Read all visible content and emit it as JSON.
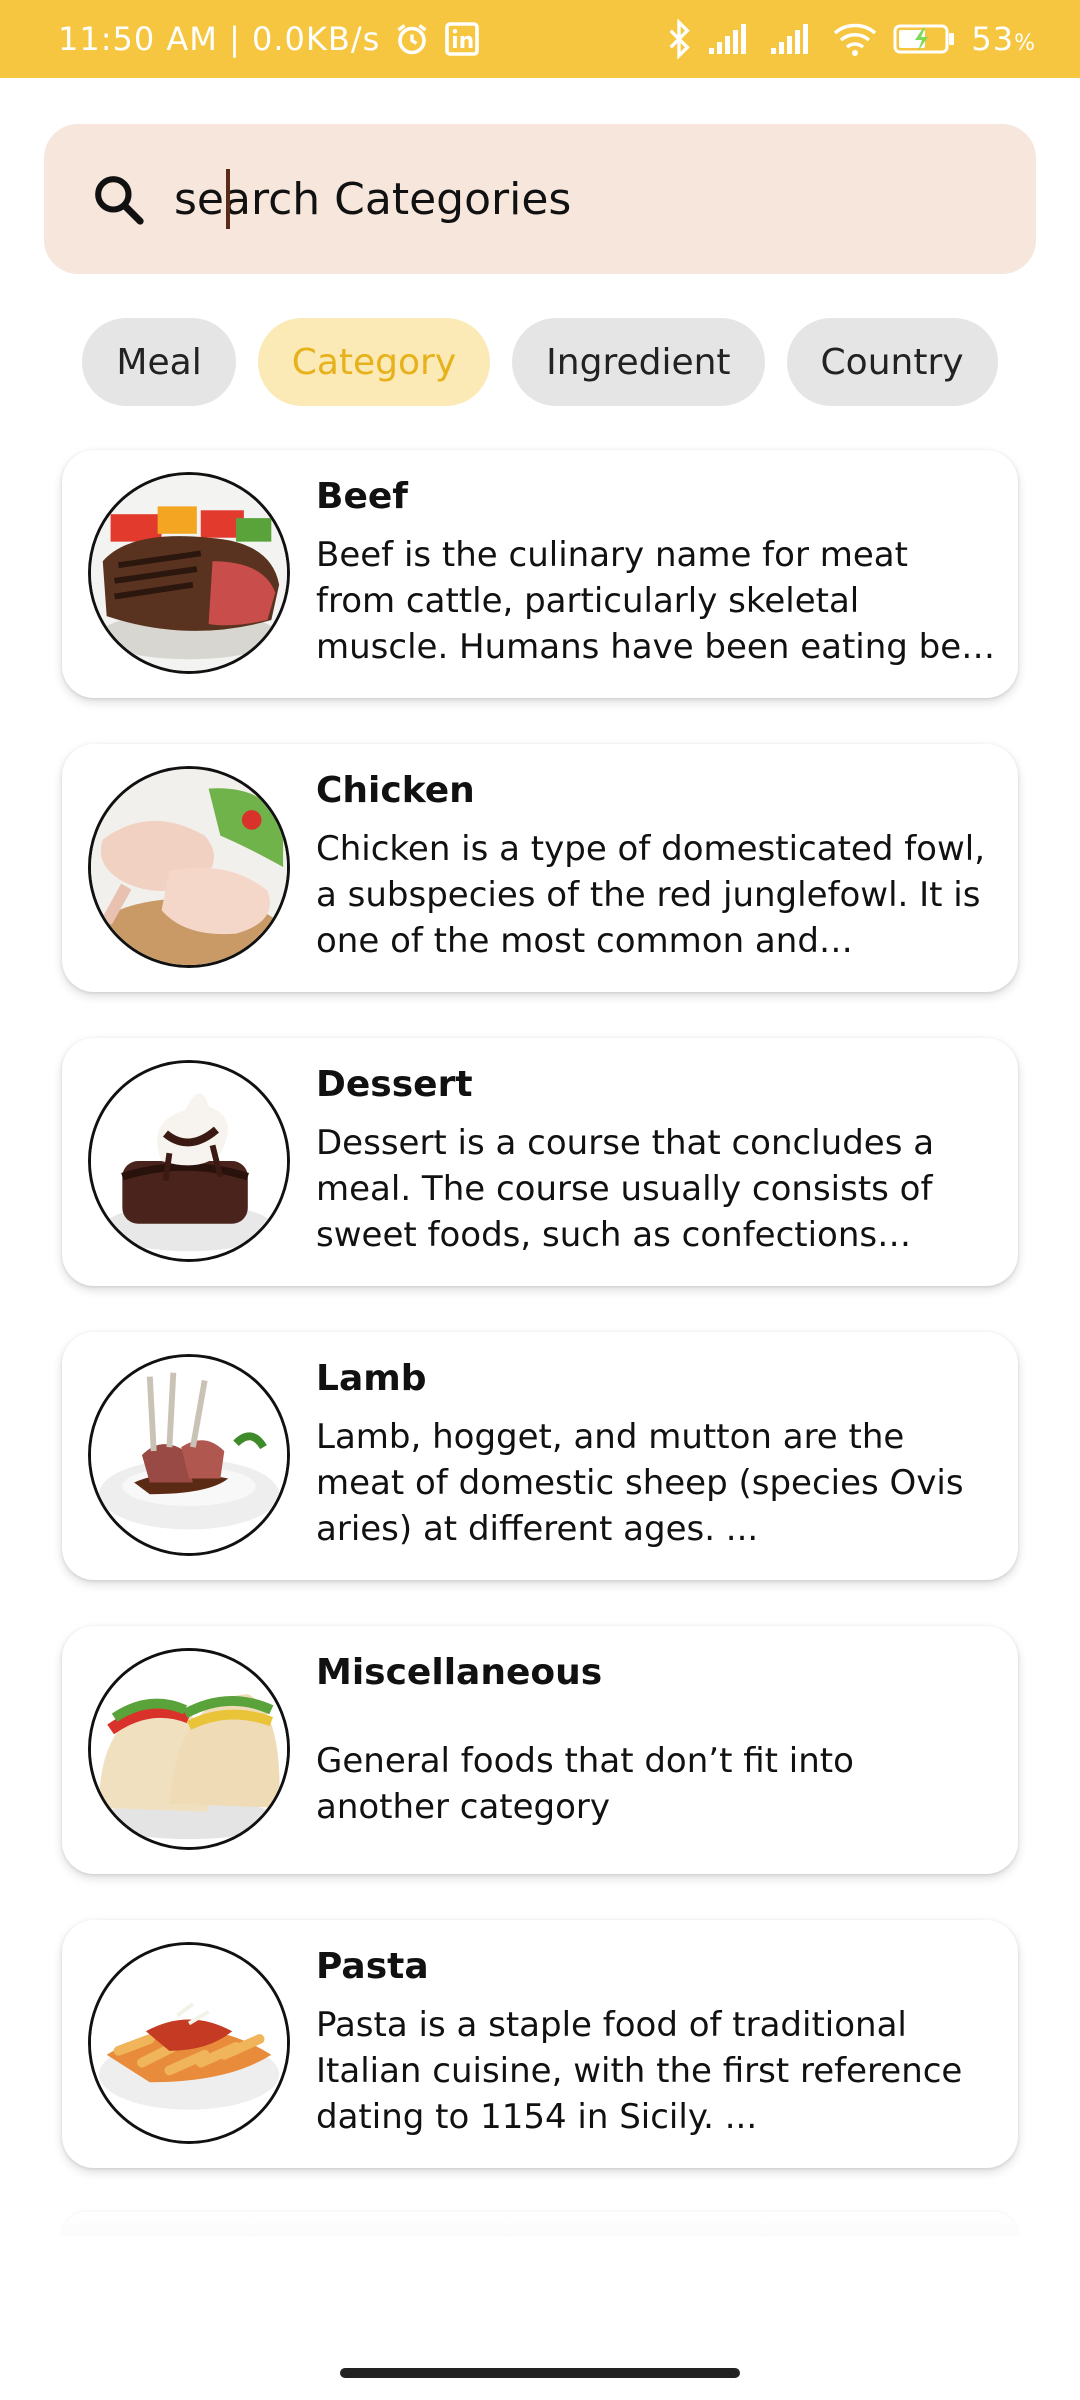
{
  "status_bar": {
    "time_speed": "11:50 AM | 0.0KB/s",
    "battery": "53",
    "battery_unit": "%",
    "icons": [
      "alarm-icon",
      "linkedin-icon",
      "bluetooth-icon",
      "signal-icon",
      "signal-icon",
      "wifi-icon",
      "battery-icon"
    ]
  },
  "search": {
    "placeholder": "search Categories",
    "icon": "search-icon"
  },
  "filters": {
    "meal": "Meal",
    "category": "Category",
    "ingredient": "Ingredient",
    "country": "Country",
    "selected": "Category",
    "selected_color": "#e7b11b",
    "selected_bg": "#fbeab6"
  },
  "categories": [
    {
      "title": "Beef",
      "description": "Beef is the culinary name for meat from cattle, particularly skeletal muscle. Humans have been eating beef since prehistoric times."
    },
    {
      "title": "Chicken",
      "description": "Chicken is a type of domesticated fowl, a subspecies of the red junglefowl. It is one of the most common and widespread domestic animals."
    },
    {
      "title": "Dessert",
      "description": "Dessert is a course that concludes a meal. The course usually consists of sweet foods, such as confections dishes or fruit."
    },
    {
      "title": "Lamb",
      "description": "Lamb, hogget, and mutton are the meat of domestic sheep (species Ovis aries) at different ages. ..."
    },
    {
      "title": "Miscellaneous",
      "description": "General foods that don’t fit into another category"
    },
    {
      "title": "Pasta",
      "description": "Pasta is a staple food of traditional Italian cuisine, with the first reference dating to 1154 in Sicily. ..."
    }
  ],
  "colors": {
    "status_bar": "#f6c640",
    "search_bg": "#f6e6dc",
    "chip_bg": "#e5e5e5"
  }
}
